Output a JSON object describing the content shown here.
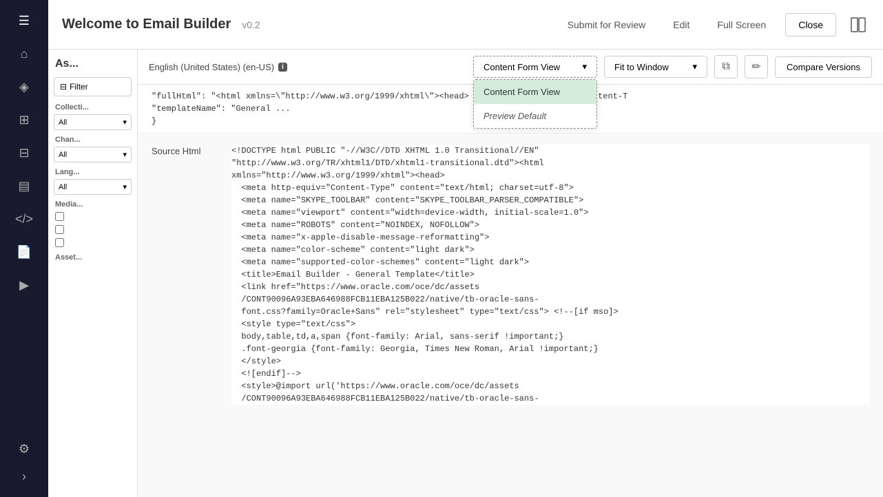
{
  "sidebar": {
    "icons": [
      {
        "name": "menu-icon",
        "symbol": "☰"
      },
      {
        "name": "home-icon",
        "symbol": "⌂"
      },
      {
        "name": "cube-icon",
        "symbol": "◈"
      },
      {
        "name": "table-icon",
        "symbol": "⊞"
      },
      {
        "name": "grid-icon",
        "symbol": "⊟"
      },
      {
        "name": "chart-icon",
        "symbol": "📊"
      },
      {
        "name": "code-icon",
        "symbol": "⟨⟩"
      },
      {
        "name": "settings-icon",
        "symbol": "⚙"
      },
      {
        "name": "media-icon",
        "symbol": "▶"
      },
      {
        "name": "gear-icon",
        "symbol": "⚙"
      },
      {
        "name": "expand-icon",
        "symbol": "›"
      }
    ]
  },
  "header": {
    "title": "Welcome to Email Builder",
    "version": "v0.2",
    "submit_label": "Submit for Review",
    "edit_label": "Edit",
    "fullscreen_label": "Full Screen",
    "close_label": "Close"
  },
  "toolbar": {
    "locale": "English (United States) (en-US)",
    "info_badge": "i",
    "view_dropdown": {
      "selected": "Content Form View",
      "options": [
        {
          "label": "Content Form View",
          "selected": true,
          "italic": false
        },
        {
          "label": "Preview Default",
          "selected": false,
          "italic": true
        }
      ]
    },
    "fit_window": "Fit to Window",
    "compare_label": "Compare Versions"
  },
  "json_preview": {
    "line1": "    \"fullHtml\": \"<html xmlns=\\\"http://www.w3.org/1999/xhtml\\\"><head> \\n  <meta http-equiv=\\\"Content-T",
    "line2": "    \"templateName\": \"General ...",
    "line3": "  }"
  },
  "source_html": {
    "label": "Source Html",
    "lines": [
      "<!DOCTYPE html PUBLIC \"-//W3C//DTD XHTML 1.0 Transitional//EN\"",
      "\"http://www.w3.org/TR/xhtml1/DTD/xhtml1-transitional.dtd\"><html",
      "xmlns=\"http://www.w3.org/1999/xhtml\"><head>",
      "  <meta http-equiv=\"Content-Type\" content=\"text/html; charset=utf-8\">",
      "  <meta name=\"SKYPE_TOOLBAR\" content=\"SKYPE_TOOLBAR_PARSER_COMPATIBLE\">",
      "  <meta name=\"viewport\" content=\"width=device-width, initial-scale=1.0\">",
      "  <meta name=\"ROBOTS\" content=\"NOINDEX, NOFOLLOW\">",
      "  <meta name=\"x-apple-disable-message-reformatting\">",
      "  <meta name=\"color-scheme\" content=\"light dark\">",
      "  <meta name=\"supported-color-schemes\" content=\"light dark\">",
      "  <title>Email Builder - General Template</title>",
      "  <link href=\"https://www.oracle.com/oce/dc/assets",
      "  /CONT90096A93EBA646988FCB11EBA125B022/native/tb-oracle-sans-",
      "  font.css?family=Oracle+Sans\" rel=\"stylesheet\" type=\"text/css\"> <!--[if mso]>",
      "  <style type=\"text/css\">",
      "  body,table,td,a,span {font-family: Arial, sans-serif !important;}",
      "  .font-georgia {font-family: Georgia, Times New Roman, Arial !important;}",
      "  </style>",
      "  <![endif]-->",
      "  <style>@import url('https://www.oracle.com/oce/dc/assets",
      "  /CONT90096A93EBA646988FCB11EBA125B022/native/tb-oracle-sans-"
    ]
  },
  "left_panel": {
    "title": "As...",
    "filter_btn": "Filter",
    "sections": [
      {
        "label": "Collecti...",
        "dropdown_value": "All"
      },
      {
        "label": "Chan...",
        "dropdown_value": "All"
      },
      {
        "label": "Lang...",
        "dropdown_value": "All"
      },
      {
        "label": "Media...",
        "checkboxes": [
          "",
          "",
          "",
          ""
        ]
      },
      {
        "label": "Asset..."
      }
    ]
  }
}
